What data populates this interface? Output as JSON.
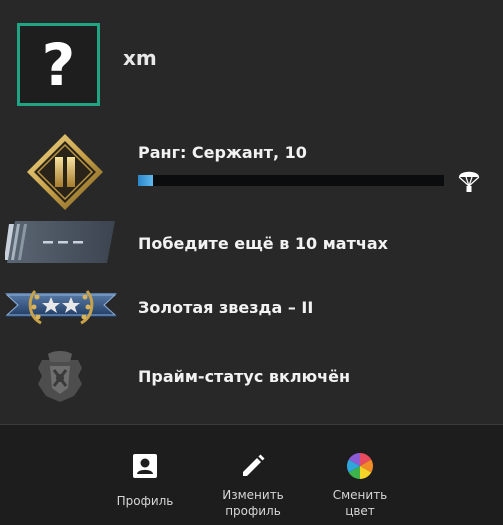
{
  "profile": {
    "avatar_glyph": "?",
    "username": "xm",
    "accent_color": "#1fa583"
  },
  "rank": {
    "label": "Ранг: Сержант, 10",
    "progress": 0.05,
    "icon": "sergeant-rank-icon",
    "progress_end_icon": "parachute-icon"
  },
  "competitive": {
    "wins_text": "Победите ещё в 10 матчах",
    "icon": "unranked-skill-group-icon"
  },
  "skill_group": {
    "label": "Золотая звезда – II",
    "icon": "gold-nova-2-icon"
  },
  "prime": {
    "label": "Прайм-статус включён",
    "icon": "prime-badge-icon"
  },
  "footer": {
    "profile_label": "Профиль",
    "edit_label": "Изменить\nпрофиль",
    "color_label": "Сменить\nцвет"
  }
}
